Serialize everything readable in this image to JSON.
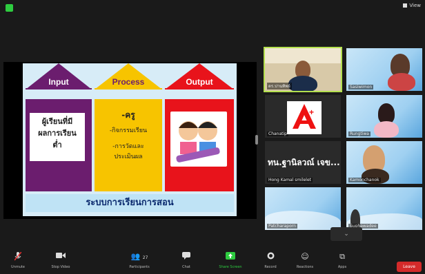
{
  "window": {
    "view_label": "View"
  },
  "slide": {
    "headers": {
      "input": "Input",
      "process": "Process",
      "output": "Output"
    },
    "input_text": [
      "ผู้เรียนที่มี",
      "ผลการเรียน",
      "ต่ำ"
    ],
    "process_items": [
      "-ครู",
      "-กิจกรรมเรียน",
      "-การวัดและ",
      "ประเมินผล"
    ],
    "footer": "ระบบการเรียนการสอน",
    "colors": {
      "input": "#6b1d6e",
      "process": "#f7c400",
      "output": "#e8131b"
    }
  },
  "gallery": {
    "tiles": [
      {
        "name": "ดร.ปานทิพย์",
        "kind": "camera"
      },
      {
        "name": "Sasiwimon",
        "kind": "camera"
      },
      {
        "name": "Chanatip",
        "kind": "logo"
      },
      {
        "name": "Rungtiwa",
        "kind": "camera"
      },
      {
        "name": "Hong Kamal smilelet",
        "kind": "name-only",
        "display": "ทน.ฐานิลวณ์ เจข..."
      },
      {
        "name": "Kamonchanok",
        "kind": "camera"
      },
      {
        "name": "Patcharaporn",
        "kind": "camera"
      },
      {
        "name": "Suphawadee",
        "kind": "camera"
      }
    ]
  },
  "toolbar": {
    "buttons": [
      {
        "label": "Unmute",
        "icon": "microphone-icon"
      },
      {
        "label": "Stop Video",
        "icon": "video-camera-icon"
      },
      {
        "label": "Participants",
        "icon": "participants-icon",
        "count": "27"
      },
      {
        "label": "Chat",
        "icon": "chat-icon"
      },
      {
        "label": "Share Screen",
        "icon": "share-screen-icon"
      },
      {
        "label": "Record",
        "icon": "record-icon"
      },
      {
        "label": "Reactions",
        "icon": "reactions-icon"
      },
      {
        "label": "Apps",
        "icon": "apps-icon"
      }
    ],
    "leave_label": "Leave",
    "leave_color": "#d42a2a",
    "share_color": "#2ecc40"
  }
}
